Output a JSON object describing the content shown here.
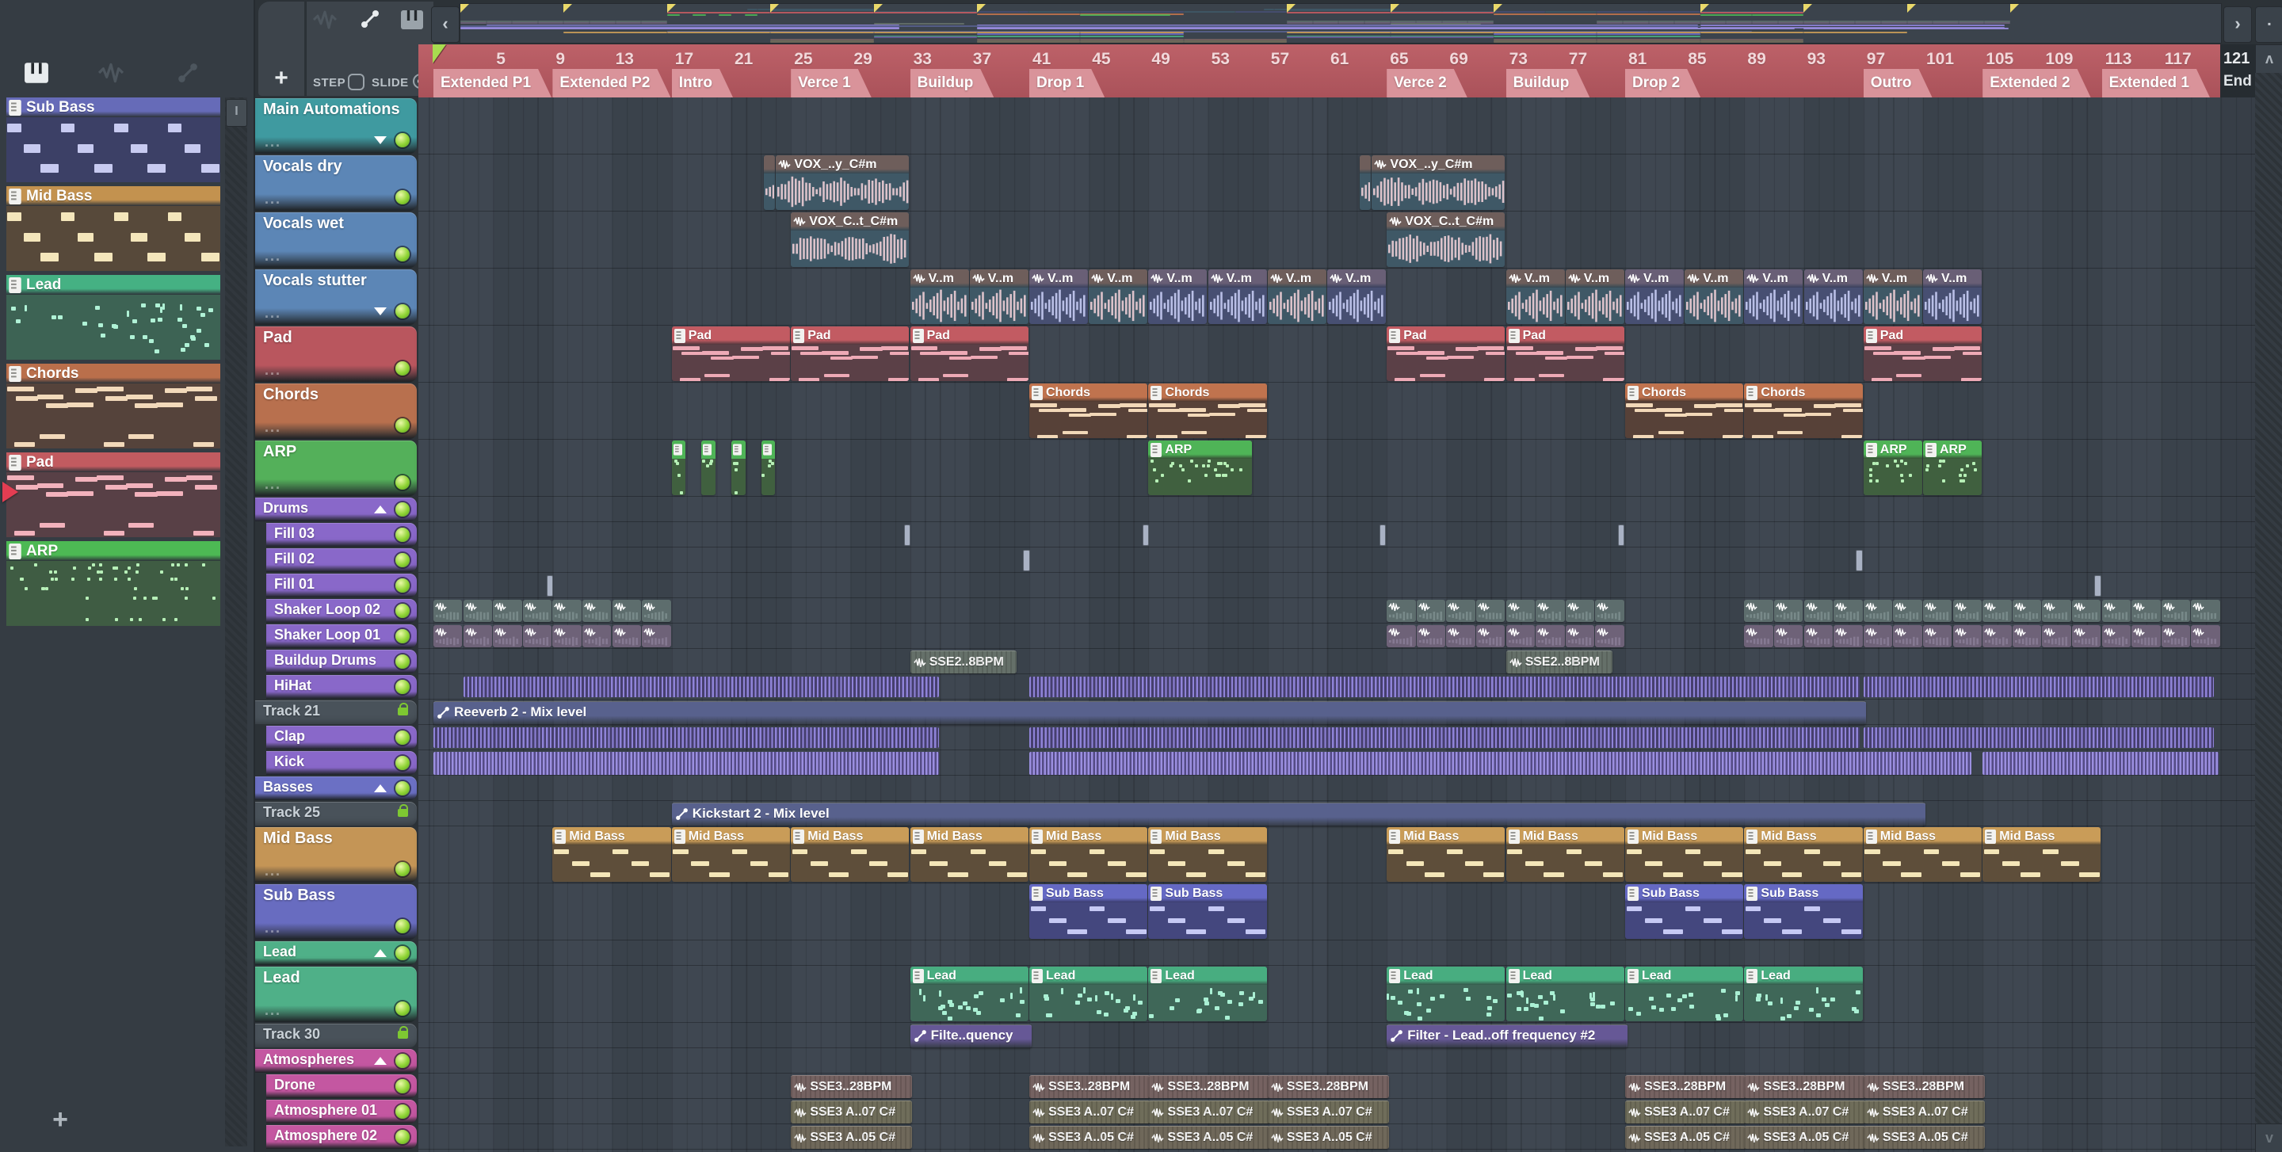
{
  "toolbar": {
    "step_label": "STEP",
    "slide_label": "SLIDE",
    "add_pattern": "+",
    "picker_add": "+",
    "nav_left": "‹",
    "nav_right": "›",
    "dot": "▪",
    "scroll_up": "ʌ",
    "scroll_down": "v"
  },
  "picker": {
    "patterns": [
      {
        "name": "Sub Bass",
        "header": "#666bb8",
        "body": "#3c4066",
        "note": "#c7caf0",
        "motif": "bass"
      },
      {
        "name": "Mid Bass",
        "header": "#c3924f",
        "body": "#57493a",
        "note": "#f4e6bb",
        "motif": "bass"
      },
      {
        "name": "Lead",
        "header": "#45b183",
        "body": "#3d6354",
        "note": "#b0f2d6",
        "motif": "lead"
      },
      {
        "name": "Chords",
        "header": "#ba6f4b",
        "body": "#55433b",
        "note": "#f2d9ba",
        "motif": "chords"
      },
      {
        "name": "Pad",
        "header": "#c25b60",
        "body": "#584046",
        "note": "#f2b2bc",
        "motif": "chords"
      },
      {
        "name": "ARP",
        "header": "#4db954",
        "body": "#3f5c43",
        "note": "#b7f0b8",
        "motif": "arp"
      }
    ]
  },
  "tracks": [
    {
      "label": "Main Automations",
      "color": "#3f9aa0",
      "size": "L",
      "dots": "...",
      "arrow": "down"
    },
    {
      "label": "Vocals dry",
      "color": "#5c86b6",
      "size": "L",
      "dots": "..."
    },
    {
      "label": "Vocals wet",
      "color": "#5c86b6",
      "size": "L",
      "dots": "..."
    },
    {
      "label": "Vocals stutter",
      "color": "#5c86b6",
      "size": "L",
      "dots": "...",
      "arrow": "down"
    },
    {
      "label": "Pad",
      "color": "#b9565e",
      "size": "L",
      "dots": "..."
    },
    {
      "label": "Chords",
      "color": "#b8704e",
      "size": "L",
      "dots": "..."
    },
    {
      "label": "ARP",
      "color": "#54b05a",
      "size": "L",
      "dots": "..."
    },
    {
      "label": "Drums",
      "color": "#8968c9",
      "size": "S",
      "kind": "group",
      "arrow": "up"
    },
    {
      "label": "Fill 03",
      "color": "#8968c9",
      "size": "S",
      "indent": true
    },
    {
      "label": "Fill 02",
      "color": "#8968c9",
      "size": "S",
      "indent": true
    },
    {
      "label": "Fill 01",
      "color": "#8968c9",
      "size": "S",
      "indent": true
    },
    {
      "label": "Shaker Loop 02",
      "color": "#8968c9",
      "size": "S",
      "indent": true
    },
    {
      "label": "Shaker Loop 01",
      "color": "#8968c9",
      "size": "S",
      "indent": true
    },
    {
      "label": "Buildup Drums",
      "color": "#8968c9",
      "size": "S",
      "indent": true
    },
    {
      "label": "HiHat",
      "color": "#8968c9",
      "size": "S",
      "indent": true
    },
    {
      "label": "Track 21",
      "color": "#49525a",
      "size": "S",
      "kind": "locked"
    },
    {
      "label": "Clap",
      "color": "#8968c9",
      "size": "S",
      "indent": true
    },
    {
      "label": "Kick",
      "color": "#8968c9",
      "size": "S",
      "indent": true
    },
    {
      "label": "Basses",
      "color": "#6b70c4",
      "size": "S",
      "kind": "group",
      "arrow": "up"
    },
    {
      "label": "Track 25",
      "color": "#49525a",
      "size": "S",
      "kind": "locked"
    },
    {
      "label": "Mid Bass",
      "color": "#c49556",
      "size": "L",
      "dots": "..."
    },
    {
      "label": "Sub Bass",
      "color": "#686cc0",
      "size": "L",
      "dots": "..."
    },
    {
      "label": "Lead",
      "color": "#4fb088",
      "size": "S",
      "kind": "group",
      "arrow": "up"
    },
    {
      "label": "Lead",
      "color": "#4fb088",
      "size": "L",
      "dots": "..."
    },
    {
      "label": "Track 30",
      "color": "#49525a",
      "size": "S",
      "kind": "locked"
    },
    {
      "label": "Atmospheres",
      "color": "#c457a1",
      "size": "S",
      "kind": "group",
      "arrow": "up"
    },
    {
      "label": "Drone",
      "color": "#c457a1",
      "size": "S",
      "indent": true
    },
    {
      "label": "Atmosphere 01",
      "color": "#c457a1",
      "size": "S",
      "indent": true
    },
    {
      "label": "Atmosphere 02",
      "color": "#c457a1",
      "size": "S",
      "indent": true
    }
  ],
  "timeline": {
    "numbers": [
      5,
      9,
      13,
      17,
      21,
      25,
      29,
      33,
      37,
      41,
      45,
      49,
      53,
      57,
      61,
      65,
      69,
      73,
      77,
      81,
      85,
      89,
      93,
      97,
      101,
      105,
      109,
      113,
      117
    ],
    "end_number": "121",
    "end_label": "End",
    "sections": [
      {
        "label": "Extended P1",
        "bar": 1
      },
      {
        "label": "Extended P2",
        "bar": 9
      },
      {
        "label": "Intro",
        "bar": 17
      },
      {
        "label": "Verce 1",
        "bar": 25
      },
      {
        "label": "Buildup",
        "bar": 33
      },
      {
        "label": "Drop 1",
        "bar": 41
      },
      {
        "label": "Verce 2",
        "bar": 65
      },
      {
        "label": "Buildup",
        "bar": 73
      },
      {
        "label": "Drop 2",
        "bar": 81
      },
      {
        "label": "Outro",
        "bar": 97
      },
      {
        "label": "Extended 2",
        "bar": 105
      },
      {
        "label": "Extended 1",
        "bar": 113
      }
    ],
    "marker_bars": [
      1,
      9,
      17,
      25,
      33,
      41,
      65,
      73,
      81,
      97,
      105,
      113,
      121
    ]
  },
  "clip_styles": {
    "pattern": {
      "Pad": {
        "hd": "#c25b62",
        "bd": "#5b4047",
        "nt": "#eeaab6",
        "motif": "chords"
      },
      "Chords": {
        "hd": "#c0734e",
        "bd": "#574138",
        "nt": "#f2d8b8",
        "motif": "chords"
      },
      "ARP": {
        "hd": "#4fb457",
        "bd": "#40603f",
        "nt": "#b6f0b6",
        "motif": "arp"
      },
      "Mid Bass": {
        "hd": "#c99c58",
        "bd": "#5e4e3a",
        "nt": "#f4e6b8",
        "motif": "bass"
      },
      "Sub Bass": {
        "hd": "#6569c4",
        "bd": "#44477e",
        "nt": "#c6c9f4",
        "motif": "bass"
      },
      "Lead": {
        "hd": "#48ad80",
        "bd": "#3f6758",
        "nt": "#aaf0d4",
        "motif": "lead"
      }
    },
    "audio": {
      "a": {
        "hd": "#6e5e5b",
        "bd": "#3f5866",
        "wv": "#dcc2ca"
      },
      "b": {
        "hd": "#695f76",
        "bd": "#474f72",
        "wv": "#b9bfe6"
      }
    },
    "mini": {
      "a": {
        "bg": "#5d6d6d",
        "wv": "#8fa0a0"
      },
      "b": {
        "bg": "#6e6278",
        "wv": "#9a8da8"
      }
    },
    "sse": {
      "bg": "#657069"
    },
    "sseD": {
      "bg": "#756261"
    },
    "sseA1": {
      "bg": "#6f6d5a"
    },
    "sseA2": {
      "bg": "#6f685a"
    },
    "auto": {
      "bg": "#58618d"
    },
    "auto2": {
      "bg": "#665896"
    },
    "stripes": {
      "hh": {
        "bg": "#463f6e",
        "ln": "#8f83d8"
      },
      "cl": {
        "bg": "#463f6e",
        "ln": "#8f83d8"
      },
      "k": {
        "bg": "#544b85",
        "ln": "#9b8fe0"
      }
    }
  },
  "clips": [
    {
      "t": 1,
      "y": "audio",
      "l": "",
      "v": "a",
      "s": 23.2,
      "e": 24
    },
    {
      "t": 1,
      "y": "audio",
      "l": "VOX_..y_C#m",
      "v": "a",
      "s": 24,
      "e": 33
    },
    {
      "t": 1,
      "y": "audio",
      "l": "",
      "v": "a",
      "s": 63.2,
      "e": 64
    },
    {
      "t": 1,
      "y": "audio",
      "l": "VOX_..y_C#m",
      "v": "a",
      "s": 64,
      "e": 73
    },
    {
      "t": 2,
      "y": "audio",
      "l": "VOX_C..t_C#m",
      "v": "a",
      "s": 25,
      "e": 33
    },
    {
      "t": 2,
      "y": "audio",
      "l": "VOX_C..t_C#m",
      "v": "a",
      "s": 65,
      "e": 73
    },
    {
      "t": 3,
      "y": "audio",
      "l": "V..m",
      "len": 4,
      "starts": [
        33,
        37,
        41,
        45,
        49,
        53,
        57,
        61,
        73,
        77,
        81,
        85,
        89,
        93,
        97,
        101
      ],
      "vs": [
        "a",
        "a",
        "b",
        "a",
        "b",
        "b",
        "a",
        "b",
        "a",
        "a",
        "b",
        "a",
        "b",
        "b",
        "a",
        "b"
      ]
    },
    {
      "t": 4,
      "y": "pattern",
      "l": "Pad",
      "len": 8,
      "starts": [
        17,
        25,
        33,
        65,
        73,
        97
      ]
    },
    {
      "t": 5,
      "y": "pattern",
      "l": "Chords",
      "len": 8,
      "starts": [
        41,
        49,
        81,
        89
      ]
    },
    {
      "t": 6,
      "y": "pattern",
      "l": "",
      "k": "ARP",
      "len": 1,
      "starts": [
        17,
        19,
        21,
        23
      ]
    },
    {
      "t": 6,
      "y": "pattern",
      "l": "ARP",
      "s": 49,
      "e": 56
    },
    {
      "t": 6,
      "y": "pattern",
      "l": "ARP",
      "len": 4,
      "starts": [
        97,
        101
      ]
    },
    {
      "t": 8,
      "y": "sliver",
      "len": 0.4,
      "starts": [
        32.6,
        48.6,
        64.5,
        80.5
      ]
    },
    {
      "t": 9,
      "y": "sliver",
      "len": 0.4,
      "starts": [
        40.6,
        96.5
      ]
    },
    {
      "t": 10,
      "y": "sliver",
      "len": 0.4,
      "starts": [
        8.6,
        112.5
      ]
    },
    {
      "t": 11,
      "y": "mini",
      "v": "a",
      "len": 2,
      "starts": [
        1,
        3,
        5,
        7,
        9,
        11,
        13,
        15,
        65,
        67,
        69,
        71,
        73,
        75,
        77,
        79,
        89,
        91,
        93,
        95,
        97,
        99,
        101,
        103,
        105,
        107,
        109,
        111,
        113,
        115,
        117,
        119
      ]
    },
    {
      "t": 12,
      "y": "mini",
      "v": "b",
      "len": 2,
      "starts": [
        1,
        3,
        5,
        7,
        9,
        11,
        13,
        15,
        65,
        67,
        69,
        71,
        73,
        75,
        77,
        79,
        89,
        91,
        93,
        95,
        97,
        99,
        101,
        103,
        105,
        107,
        109,
        111,
        113,
        115,
        117,
        119
      ]
    },
    {
      "t": 13,
      "y": "sse",
      "l": "SSE2..8BPM",
      "len": 7,
      "starts": [
        33,
        73
      ]
    },
    {
      "t": 14,
      "y": "stripes",
      "v": "hh",
      "segs": [
        [
          3,
          35
        ],
        [
          41,
          96.8
        ],
        [
          97,
          120.6
        ]
      ]
    },
    {
      "t": 15,
      "y": "auto",
      "l": "Reeverb 2 - Mix level",
      "s": 1,
      "e": 97
    },
    {
      "t": 16,
      "y": "stripes",
      "v": "cl",
      "segs": [
        [
          1,
          35
        ],
        [
          41,
          96.8
        ],
        [
          97,
          120.6
        ]
      ]
    },
    {
      "t": 17,
      "y": "stripes",
      "v": "k",
      "segs": [
        [
          1,
          35
        ],
        [
          41,
          104.3
        ],
        [
          105,
          120.9
        ]
      ]
    },
    {
      "t": 19,
      "y": "auto",
      "l": "Kickstart 2 - Mix level",
      "s": 17,
      "e": 101
    },
    {
      "t": 20,
      "y": "pattern",
      "l": "Mid Bass",
      "len": 8,
      "starts": [
        9,
        17,
        25,
        33,
        41,
        49,
        65,
        73,
        81,
        89,
        97,
        105
      ]
    },
    {
      "t": 21,
      "y": "pattern",
      "l": "Sub Bass",
      "len": 8,
      "starts": [
        41,
        49,
        81,
        89
      ]
    },
    {
      "t": 23,
      "y": "pattern",
      "l": "Lead",
      "len": 8,
      "starts": [
        33,
        41,
        49,
        65,
        73,
        81,
        89
      ]
    },
    {
      "t": 24,
      "y": "auto2",
      "l": "Filte..quency",
      "s": 33,
      "e": 41
    },
    {
      "t": 24,
      "y": "auto2",
      "l": "Filter - Lead..off frequency #2",
      "s": 65,
      "e": 81
    },
    {
      "t": 26,
      "y": "sseD",
      "l": "SSE3..28BPM",
      "len": 8,
      "starts": [
        25,
        41,
        49,
        57,
        81,
        89,
        97
      ]
    },
    {
      "t": 27,
      "y": "sseA1",
      "l": "SSE3 A..07 C#",
      "len": 8,
      "starts": [
        25,
        41,
        49,
        57,
        81,
        89,
        97
      ]
    },
    {
      "t": 28,
      "y": "sseA2",
      "l": "SSE3 A..05 C#",
      "len": 8,
      "starts": [
        25,
        41,
        49,
        57,
        81,
        89,
        97
      ]
    }
  ]
}
